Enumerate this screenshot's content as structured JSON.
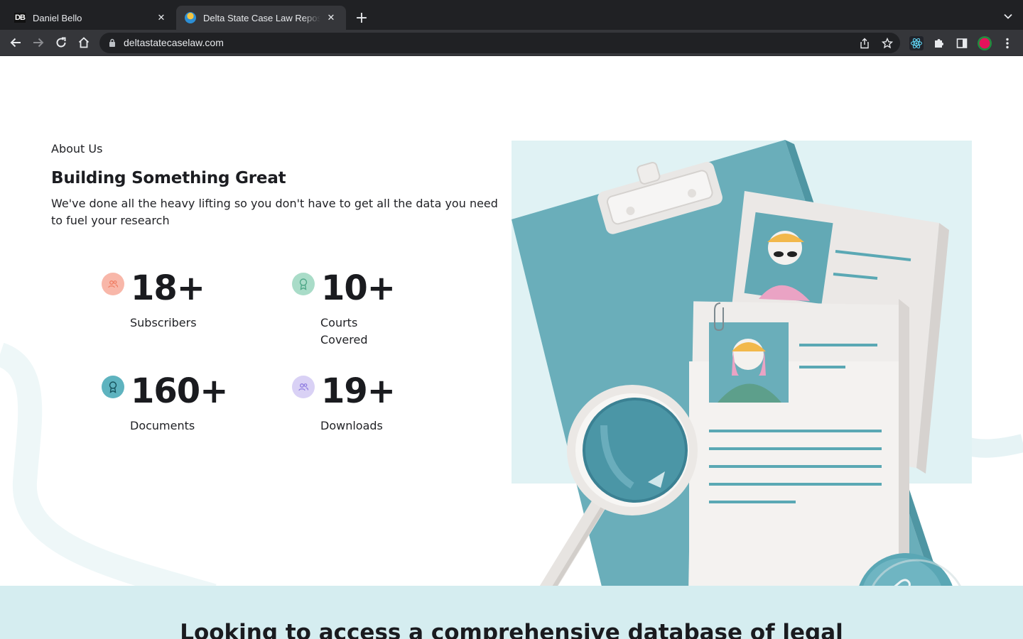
{
  "browser": {
    "tabs": [
      {
        "title": "Daniel Bello",
        "favicon": "DB"
      },
      {
        "title": "Delta State Case Law Repository",
        "favicon": "globe-logo"
      }
    ],
    "url": "deltastatecaselaw.com"
  },
  "about": {
    "label": "About Us",
    "heading": "Building Something Great",
    "description": "We've done all the heavy lifting so you don't have to get all the data you need to fuel your research"
  },
  "stats": [
    {
      "value": "18+",
      "label": "Subscribers",
      "icon": "users-icon",
      "color": "#f8b7a9"
    },
    {
      "value": "10+",
      "label": "Courts Covered",
      "icon": "award-icon",
      "color": "#a9dcc8"
    },
    {
      "value": "160+",
      "label": "Documents",
      "icon": "award-icon",
      "color": "#5eb3bf"
    },
    {
      "value": "19+",
      "label": "Downloads",
      "icon": "users-icon",
      "color": "#d9d1f5"
    }
  ],
  "cta": {
    "heading": "Looking to access a comprehensive database of legal"
  },
  "colors": {
    "accent_teal": "#5eaab5",
    "hero_bg": "#e0f2f4",
    "band_bg": "#d5edf0"
  }
}
